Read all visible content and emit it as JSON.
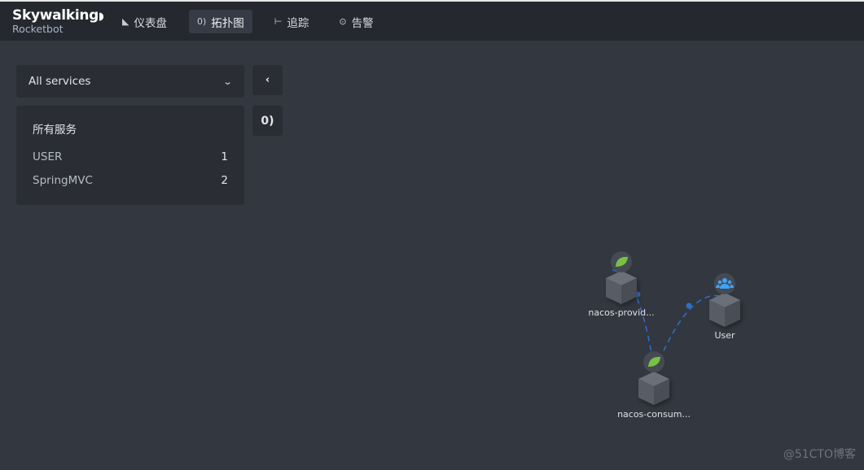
{
  "header": {
    "logo_main": "Skywalking",
    "logo_sub": "Rocketbot",
    "nav": [
      {
        "label": "仪表盘",
        "icon": "dashboard-icon",
        "glyph": "◣",
        "active": false
      },
      {
        "label": "拓扑图",
        "icon": "topology-icon",
        "glyph": "0)",
        "active": true
      },
      {
        "label": "追踪",
        "icon": "trace-icon",
        "glyph": "⊢",
        "active": false
      },
      {
        "label": "告警",
        "icon": "alarm-icon",
        "glyph": "⊙",
        "active": false
      }
    ]
  },
  "sidebar": {
    "service_select": {
      "value": "All services"
    },
    "services_panel": {
      "title": "所有服务",
      "rows": [
        {
          "name": "USER",
          "count": "1"
        },
        {
          "name": "SpringMVC",
          "count": "2"
        }
      ]
    },
    "collapse_glyph": "‹",
    "topo_glyph": "0)"
  },
  "topology": {
    "nodes": [
      {
        "id": "provider",
        "label": "nacos-provid...",
        "type": "spring",
        "color": "#7ac143"
      },
      {
        "id": "consumer",
        "label": "nacos-consum...",
        "type": "spring",
        "color": "#7ac143"
      },
      {
        "id": "user",
        "label": "User",
        "type": "user",
        "color": "#3fa3f5"
      }
    ],
    "edges": [
      {
        "from": "provider",
        "to": "consumer"
      },
      {
        "from": "user",
        "to": "consumer"
      }
    ],
    "edge_color": "#2e6fc7"
  },
  "watermark": "@51CTO博客"
}
